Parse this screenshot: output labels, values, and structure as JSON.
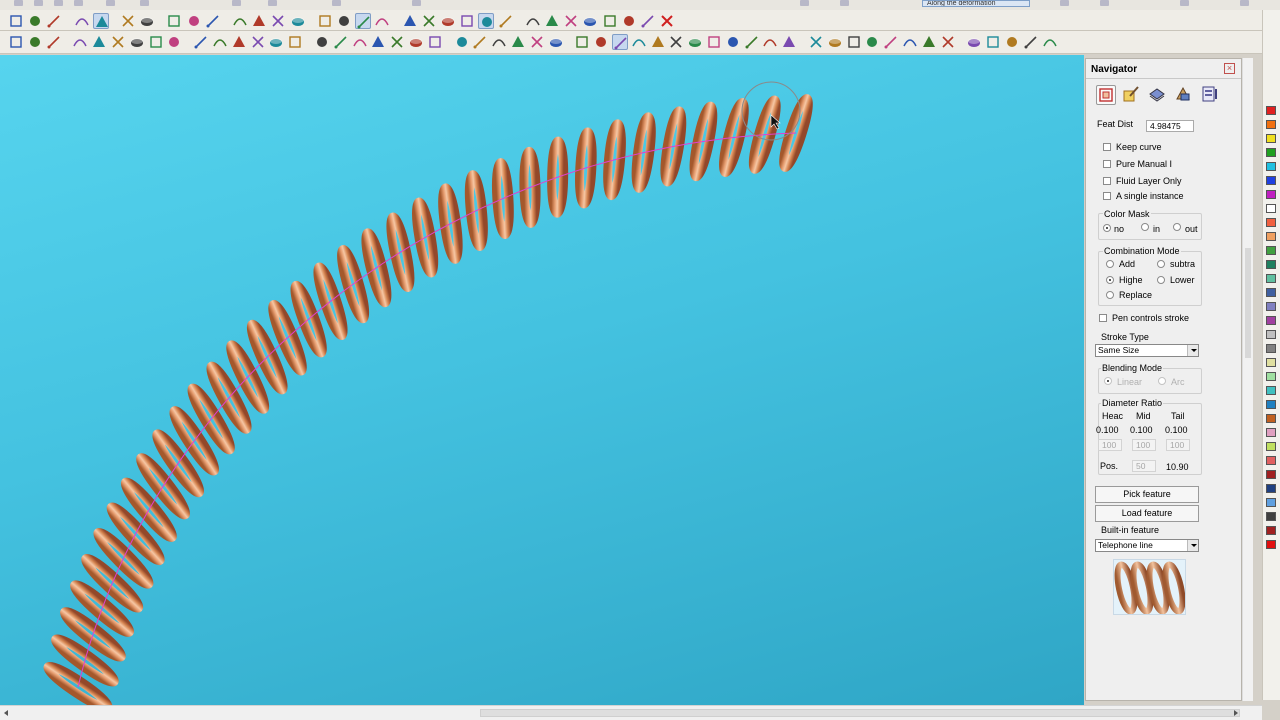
{
  "top_toolbar": {
    "transform_mode": "Along the deformation"
  },
  "toolbar_icons_row1": [
    "new-file-icon",
    "open-file-icon",
    "save-icon",
    "crosshair-icon",
    "zoom-box-icon",
    "undo-icon",
    "redo-icon",
    "cut-icon",
    "copy-icon",
    "paste-icon",
    "sphere-icon",
    "cube-view-icon",
    "filter-icon",
    "bucket-icon",
    "move-icon",
    "line-tool-icon",
    "curve-tool-icon",
    "trim-icon",
    "close-x-icon",
    "circle-target-icon",
    "snap-center-icon",
    "perpendicular-icon",
    "hand-tool-icon",
    "grid-icon",
    "edit-node-icon",
    "shade-icon",
    "render-icon",
    "texture-icon",
    "scissors-icon",
    "knife-icon",
    "sculpt-icon",
    "delete-icon"
  ],
  "toolbar_icons_row2": [
    "pan-icon",
    "dimension-icon",
    "polyline-icon",
    "arc-icon",
    "freeform-icon",
    "trim-curve-icon",
    "extend-icon",
    "blend-icon",
    "spline-icon",
    "mesh-icon",
    "relief-icon",
    "tree-icon",
    "move-green-icon",
    "green-circle-icon",
    "color-ball-icon",
    "rectangle-icon",
    "hill-icon",
    "wedge-icon",
    "disc-icon",
    "stroke-icon",
    "brush-icon",
    "pencil-icon",
    "blue-sphere-icon",
    "blue-ball-icon",
    "lattice-icon",
    "sub-icon",
    "flow-icon",
    "shape-icon",
    "bridge-icon",
    "hammer-icon",
    "pen-icon",
    "spring-icon",
    "twist-icon",
    "blob-icon",
    "star-icon",
    "knot-icon",
    "tree-green-icon",
    "pin-icon",
    "green-ball-icon",
    "t-tool-icon",
    "layers-icon",
    "yellow-square-icon",
    "gradient-icon",
    "snap-icon",
    "array-icon",
    "mirror-icon",
    "boolean-icon",
    "copy-array-icon",
    "grid-snap-icon",
    "measure-icon",
    "settings-icon",
    "frame-icon",
    "target-icon"
  ],
  "palette_colors": [
    "#e02020",
    "#f07010",
    "#f0e020",
    "#20a020",
    "#20c0e0",
    "#2040e0",
    "#c020c0",
    "#ffffff",
    "#f06040",
    "#f0a060",
    "#40a040",
    "#208060",
    "#60c0a0",
    "#4060a0",
    "#8080c0",
    "#a040a0",
    "#c0c0c0",
    "#808080",
    "#e0e0a0",
    "#a0e0a0",
    "#40c0c0",
    "#2080c0",
    "#c06020",
    "#e0a0c0",
    "#c0e060",
    "#e06060",
    "#a02020",
    "#204080",
    "#60a0e0",
    "#404040",
    "#a02020",
    "#e01010"
  ],
  "navigator": {
    "title": "Navigator",
    "tabs": [
      "select-feature-icon",
      "paint-brush-icon",
      "layers-cube-icon",
      "pattern-icon",
      "library-icon"
    ],
    "feat_dist_label": "Feat Dist",
    "feat_dist_value": "4.98475",
    "checkboxes": [
      {
        "label": "Keep curve",
        "checked": false
      },
      {
        "label": "Pure Manual I",
        "checked": false
      },
      {
        "label": "Fluid Layer Only",
        "checked": false
      },
      {
        "label": "A single instance",
        "checked": false
      }
    ],
    "color_mask": {
      "title": "Color Mask",
      "options": [
        "no",
        "in",
        "out"
      ],
      "selected": "no"
    },
    "combination_mode": {
      "title": "Combination Mode",
      "options": [
        "Add",
        "subtra",
        "Highe",
        "Lower",
        "Replace"
      ],
      "selected": "Highe"
    },
    "pen_controls_stroke": {
      "label": "Pen controls stroke",
      "checked": false
    },
    "stroke_type": {
      "title": "Stroke Type",
      "value": "Same Size"
    },
    "blending_mode": {
      "title": "Blending Mode",
      "options": [
        "Linear",
        "Arc"
      ],
      "selected": "Linear"
    },
    "diameter_ratio": {
      "title": "Diameter Ratio",
      "columns": [
        "Heac",
        "Mid",
        "Tail"
      ],
      "values": [
        "0.100",
        "0.100",
        "0.100"
      ],
      "inputs": [
        "100",
        "100",
        "100"
      ],
      "pos_label": "Pos.",
      "pos_input": "50",
      "pos_value": "10.90"
    },
    "pick_feature": "Pick feature",
    "load_feature": "Load feature",
    "builtin_feature": {
      "title": "Built-in feature",
      "value": "Telephone line"
    }
  }
}
